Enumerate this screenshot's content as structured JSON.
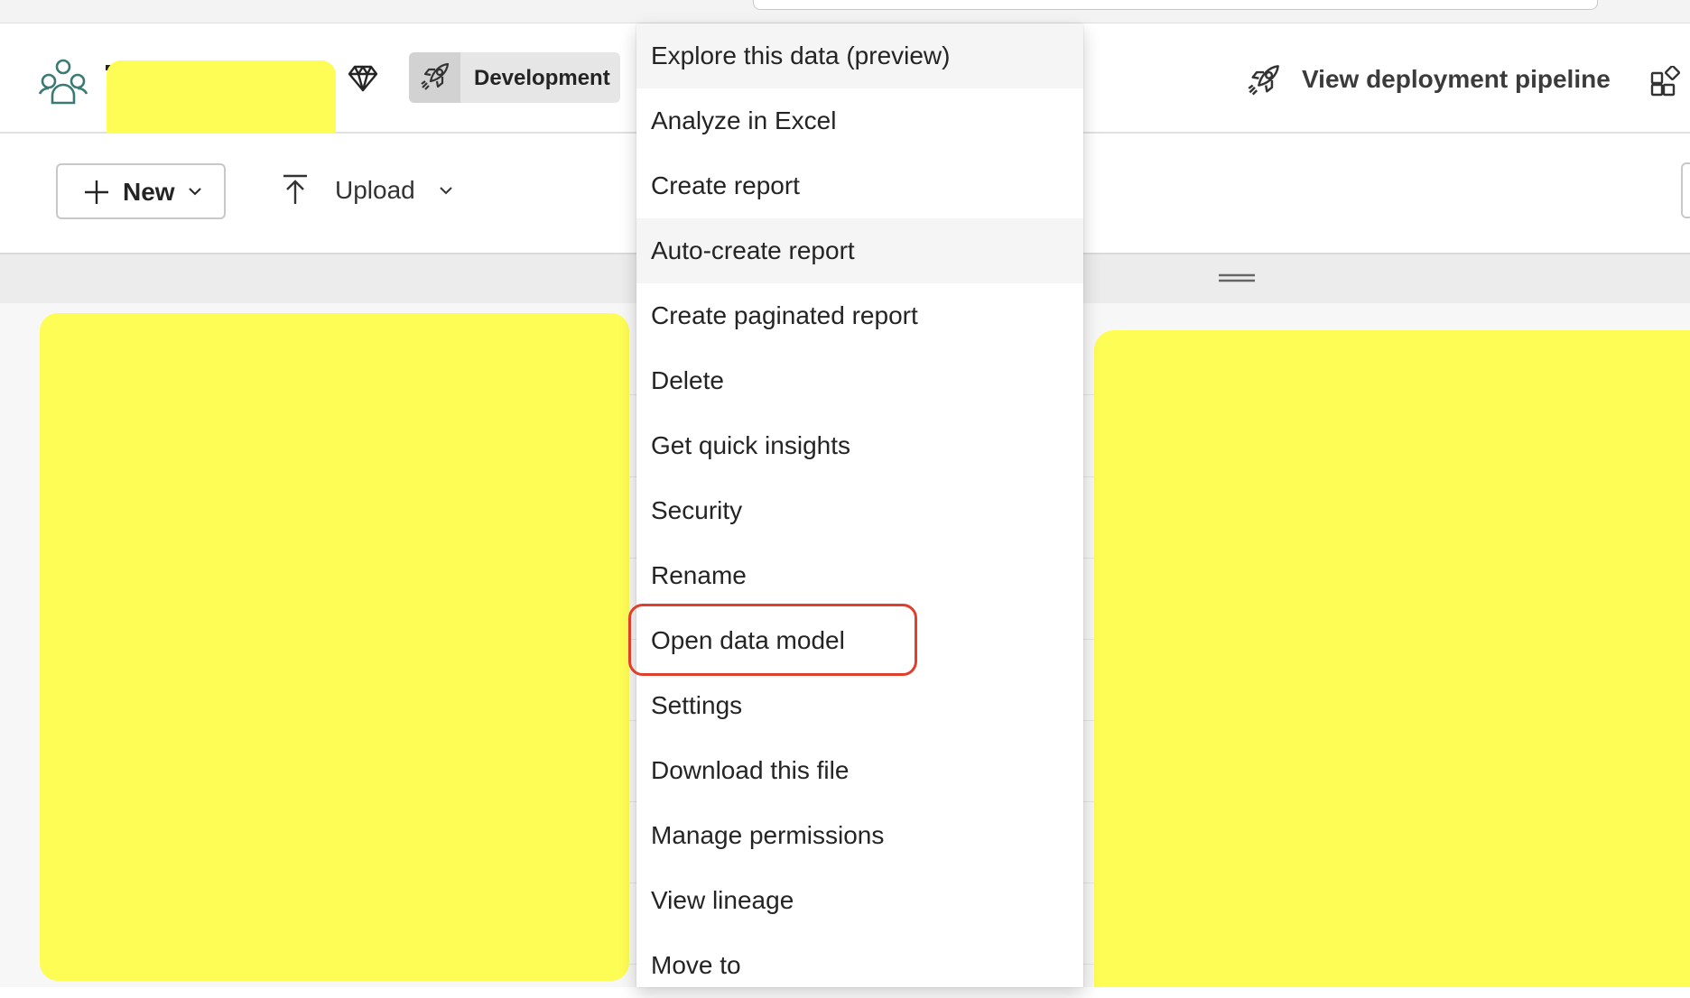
{
  "header": {
    "stage_label": "Development",
    "pipeline_label": "View deployment pipeline"
  },
  "toolbar": {
    "new_label": "New",
    "upload_label": "Upload"
  },
  "context_menu": {
    "items": [
      {
        "label": "Explore this data (preview)",
        "hovered": true
      },
      {
        "label": "Analyze in Excel"
      },
      {
        "label": "Create report"
      },
      {
        "label": "Auto-create report",
        "hovered": true
      },
      {
        "label": "Create paginated report"
      },
      {
        "label": "Delete"
      },
      {
        "label": "Get quick insights"
      },
      {
        "label": "Security"
      },
      {
        "label": "Rename"
      },
      {
        "label": "Open data model",
        "highlighted": true
      },
      {
        "label": "Settings"
      },
      {
        "label": "Download this file"
      },
      {
        "label": "Manage permissions"
      },
      {
        "label": "View lineage"
      },
      {
        "label": "Move to"
      }
    ]
  },
  "colors": {
    "accent_icon": "#3a7a72",
    "redaction": "#fefd55",
    "highlight_outline": "#e0402b"
  },
  "icons": {
    "workspace": "people-group-icon",
    "premium": "diamond-icon",
    "stage": "rocket-icon",
    "pipeline": "rocket-icon",
    "apps": "apps-add-icon",
    "new": "plus-icon",
    "upload": "arrow-upload-icon"
  }
}
